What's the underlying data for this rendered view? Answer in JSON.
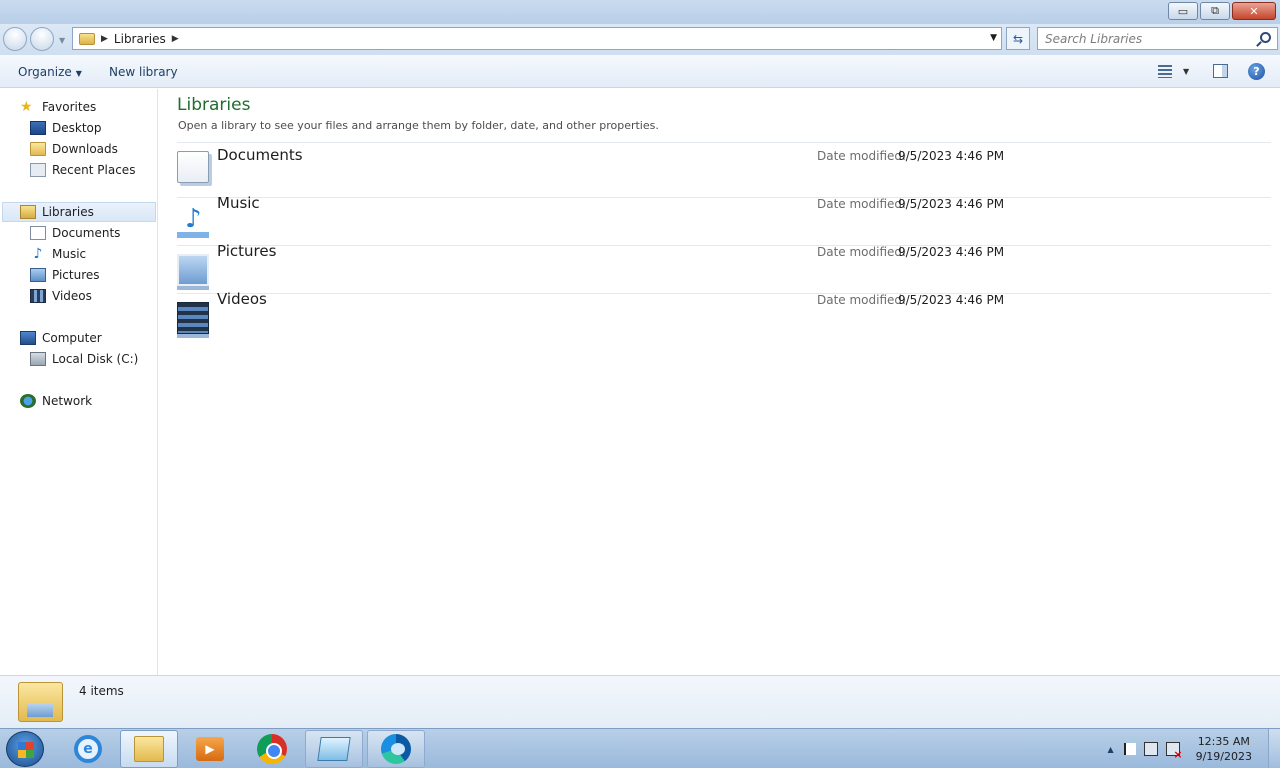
{
  "window": {
    "minimize_label": "▭",
    "maximize_label": "⧉",
    "close_label": "✕"
  },
  "address": {
    "path": [
      "Libraries"
    ],
    "search_placeholder": "Search Libraries"
  },
  "commandbar": {
    "organize_label": "Organize",
    "new_library_label": "New library"
  },
  "navigation": {
    "favorites_label": "Favorites",
    "favorites": [
      "Desktop",
      "Downloads",
      "Recent Places"
    ],
    "libraries_label": "Libraries",
    "libraries": [
      "Documents",
      "Music",
      "Pictures",
      "Videos"
    ],
    "computer_label": "Computer",
    "computer": [
      "Local Disk (C:)"
    ],
    "network_label": "Network"
  },
  "content": {
    "title": "Libraries",
    "description": "Open a library to see your files and arrange them by folder, date, and other properties.",
    "date_label": "Date modified:",
    "items": [
      {
        "name": "Documents",
        "date": "9/5/2023 4:46 PM",
        "icon": "documents-library-icon"
      },
      {
        "name": "Music",
        "date": "9/5/2023 4:46 PM",
        "icon": "music-library-icon"
      },
      {
        "name": "Pictures",
        "date": "9/5/2023 4:46 PM",
        "icon": "pictures-library-icon"
      },
      {
        "name": "Videos",
        "date": "9/5/2023 4:46 PM",
        "icon": "videos-library-icon"
      }
    ]
  },
  "details": {
    "item_count": "4 items"
  },
  "taskbar": {
    "apps": [
      "internet-explorer-icon",
      "file-explorer-icon",
      "media-player-icon",
      "chrome-icon",
      "app-icon",
      "edge-icon"
    ],
    "time": "12:35 AM",
    "date": "9/19/2023"
  },
  "colors": {
    "title_green": "#1e6e2c",
    "accent_blue": "#1e3f66"
  }
}
